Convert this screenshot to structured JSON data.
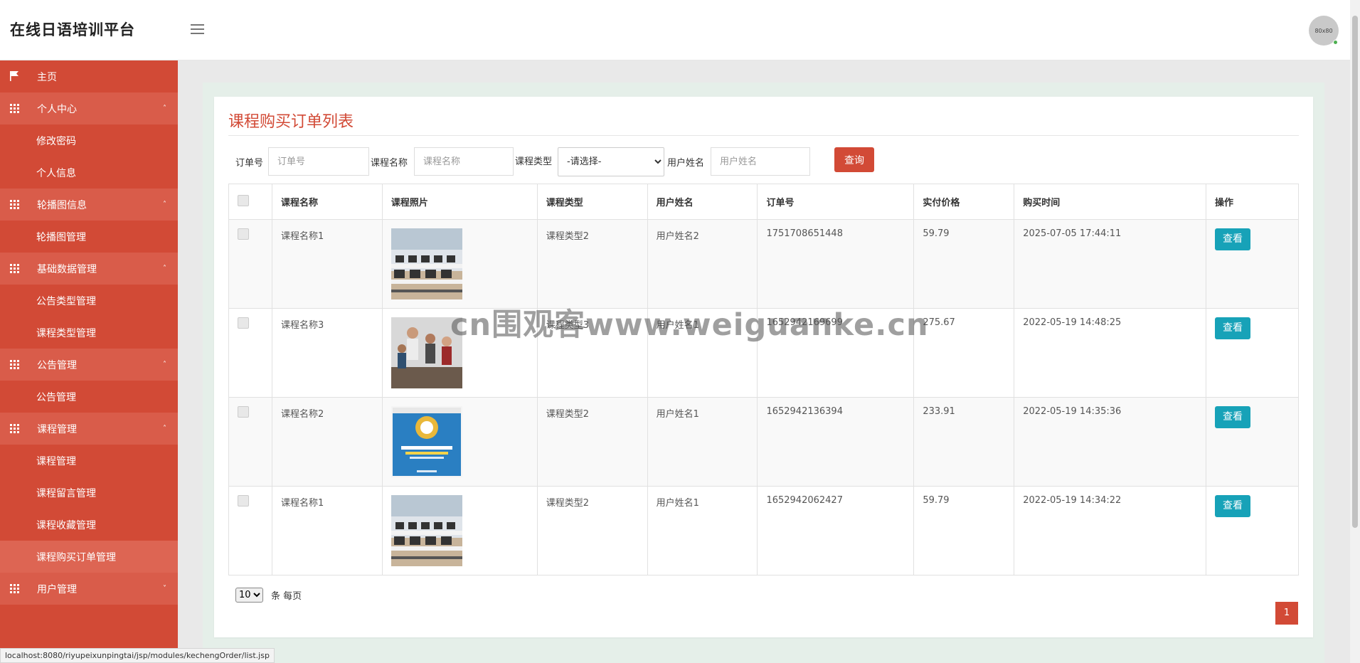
{
  "header": {
    "title": "在线日语培训平台",
    "avatar_text": "80x80"
  },
  "sidebar": {
    "home": "主页",
    "groups": [
      {
        "label": "个人中心",
        "caret": "˄",
        "items": [
          "修改密码",
          "个人信息"
        ]
      },
      {
        "label": "轮播图信息",
        "caret": "˄",
        "items": [
          "轮播图管理"
        ]
      },
      {
        "label": "基础数据管理",
        "caret": "˄",
        "items": [
          "公告类型管理",
          "课程类型管理"
        ]
      },
      {
        "label": "公告管理",
        "caret": "˄",
        "items": [
          "公告管理"
        ]
      },
      {
        "label": "课程管理",
        "caret": "˄",
        "items": [
          "课程管理",
          "课程留言管理",
          "课程收藏管理",
          "课程购买订单管理"
        ]
      },
      {
        "label": "用户管理",
        "caret": "˅",
        "items": []
      }
    ],
    "active_item": "课程购买订单管理"
  },
  "main": {
    "title": "课程购买订单列表",
    "filters": {
      "order_label": "订单号",
      "order_placeholder": "订单号",
      "course_label": "课程名称",
      "course_placeholder": "课程名称",
      "type_label": "课程类型",
      "type_selected": "-请选择-",
      "user_label": "用户姓名",
      "user_placeholder": "用户姓名",
      "search_button": "查询"
    },
    "table": {
      "headers": [
        "课程名称",
        "课程照片",
        "课程类型",
        "用户姓名",
        "订单号",
        "实付价格",
        "购买时间",
        "操作"
      ],
      "rows": [
        {
          "course": "课程名称1",
          "photo": "classroom-computers",
          "type": "课程类型2",
          "user": "用户姓名2",
          "order_no": "1751708651448",
          "price": "59.79",
          "time": "2025-07-05 17:44:11",
          "action": "查看"
        },
        {
          "course": "课程名称3",
          "photo": "students-group",
          "type": "课程类型3",
          "user": "用户姓名1",
          "order_no": "1652942169699",
          "price": "275.67",
          "time": "2022-05-19 14:48:25",
          "action": "查看"
        },
        {
          "course": "课程名称2",
          "photo": "java-book-cover",
          "type": "课程类型2",
          "user": "用户姓名1",
          "order_no": "1652942136394",
          "price": "233.91",
          "time": "2022-05-19 14:35:36",
          "action": "查看"
        },
        {
          "course": "课程名称1",
          "photo": "classroom-computers",
          "type": "课程类型2",
          "user": "用户姓名1",
          "order_no": "1652942062427",
          "price": "59.79",
          "time": "2022-05-19 14:34:22",
          "action": "查看"
        }
      ]
    },
    "page_size": "10",
    "page_size_label": "条 每页",
    "current_page": "1"
  },
  "watermark": "cn围观客www.weiguanke.cn",
  "status_url": "localhost:8080/riyupeixunpingtai/jsp/modules/kechengOrder/list.jsp",
  "colors": {
    "accent": "#d24a36",
    "view_button": "#17a2b8"
  }
}
